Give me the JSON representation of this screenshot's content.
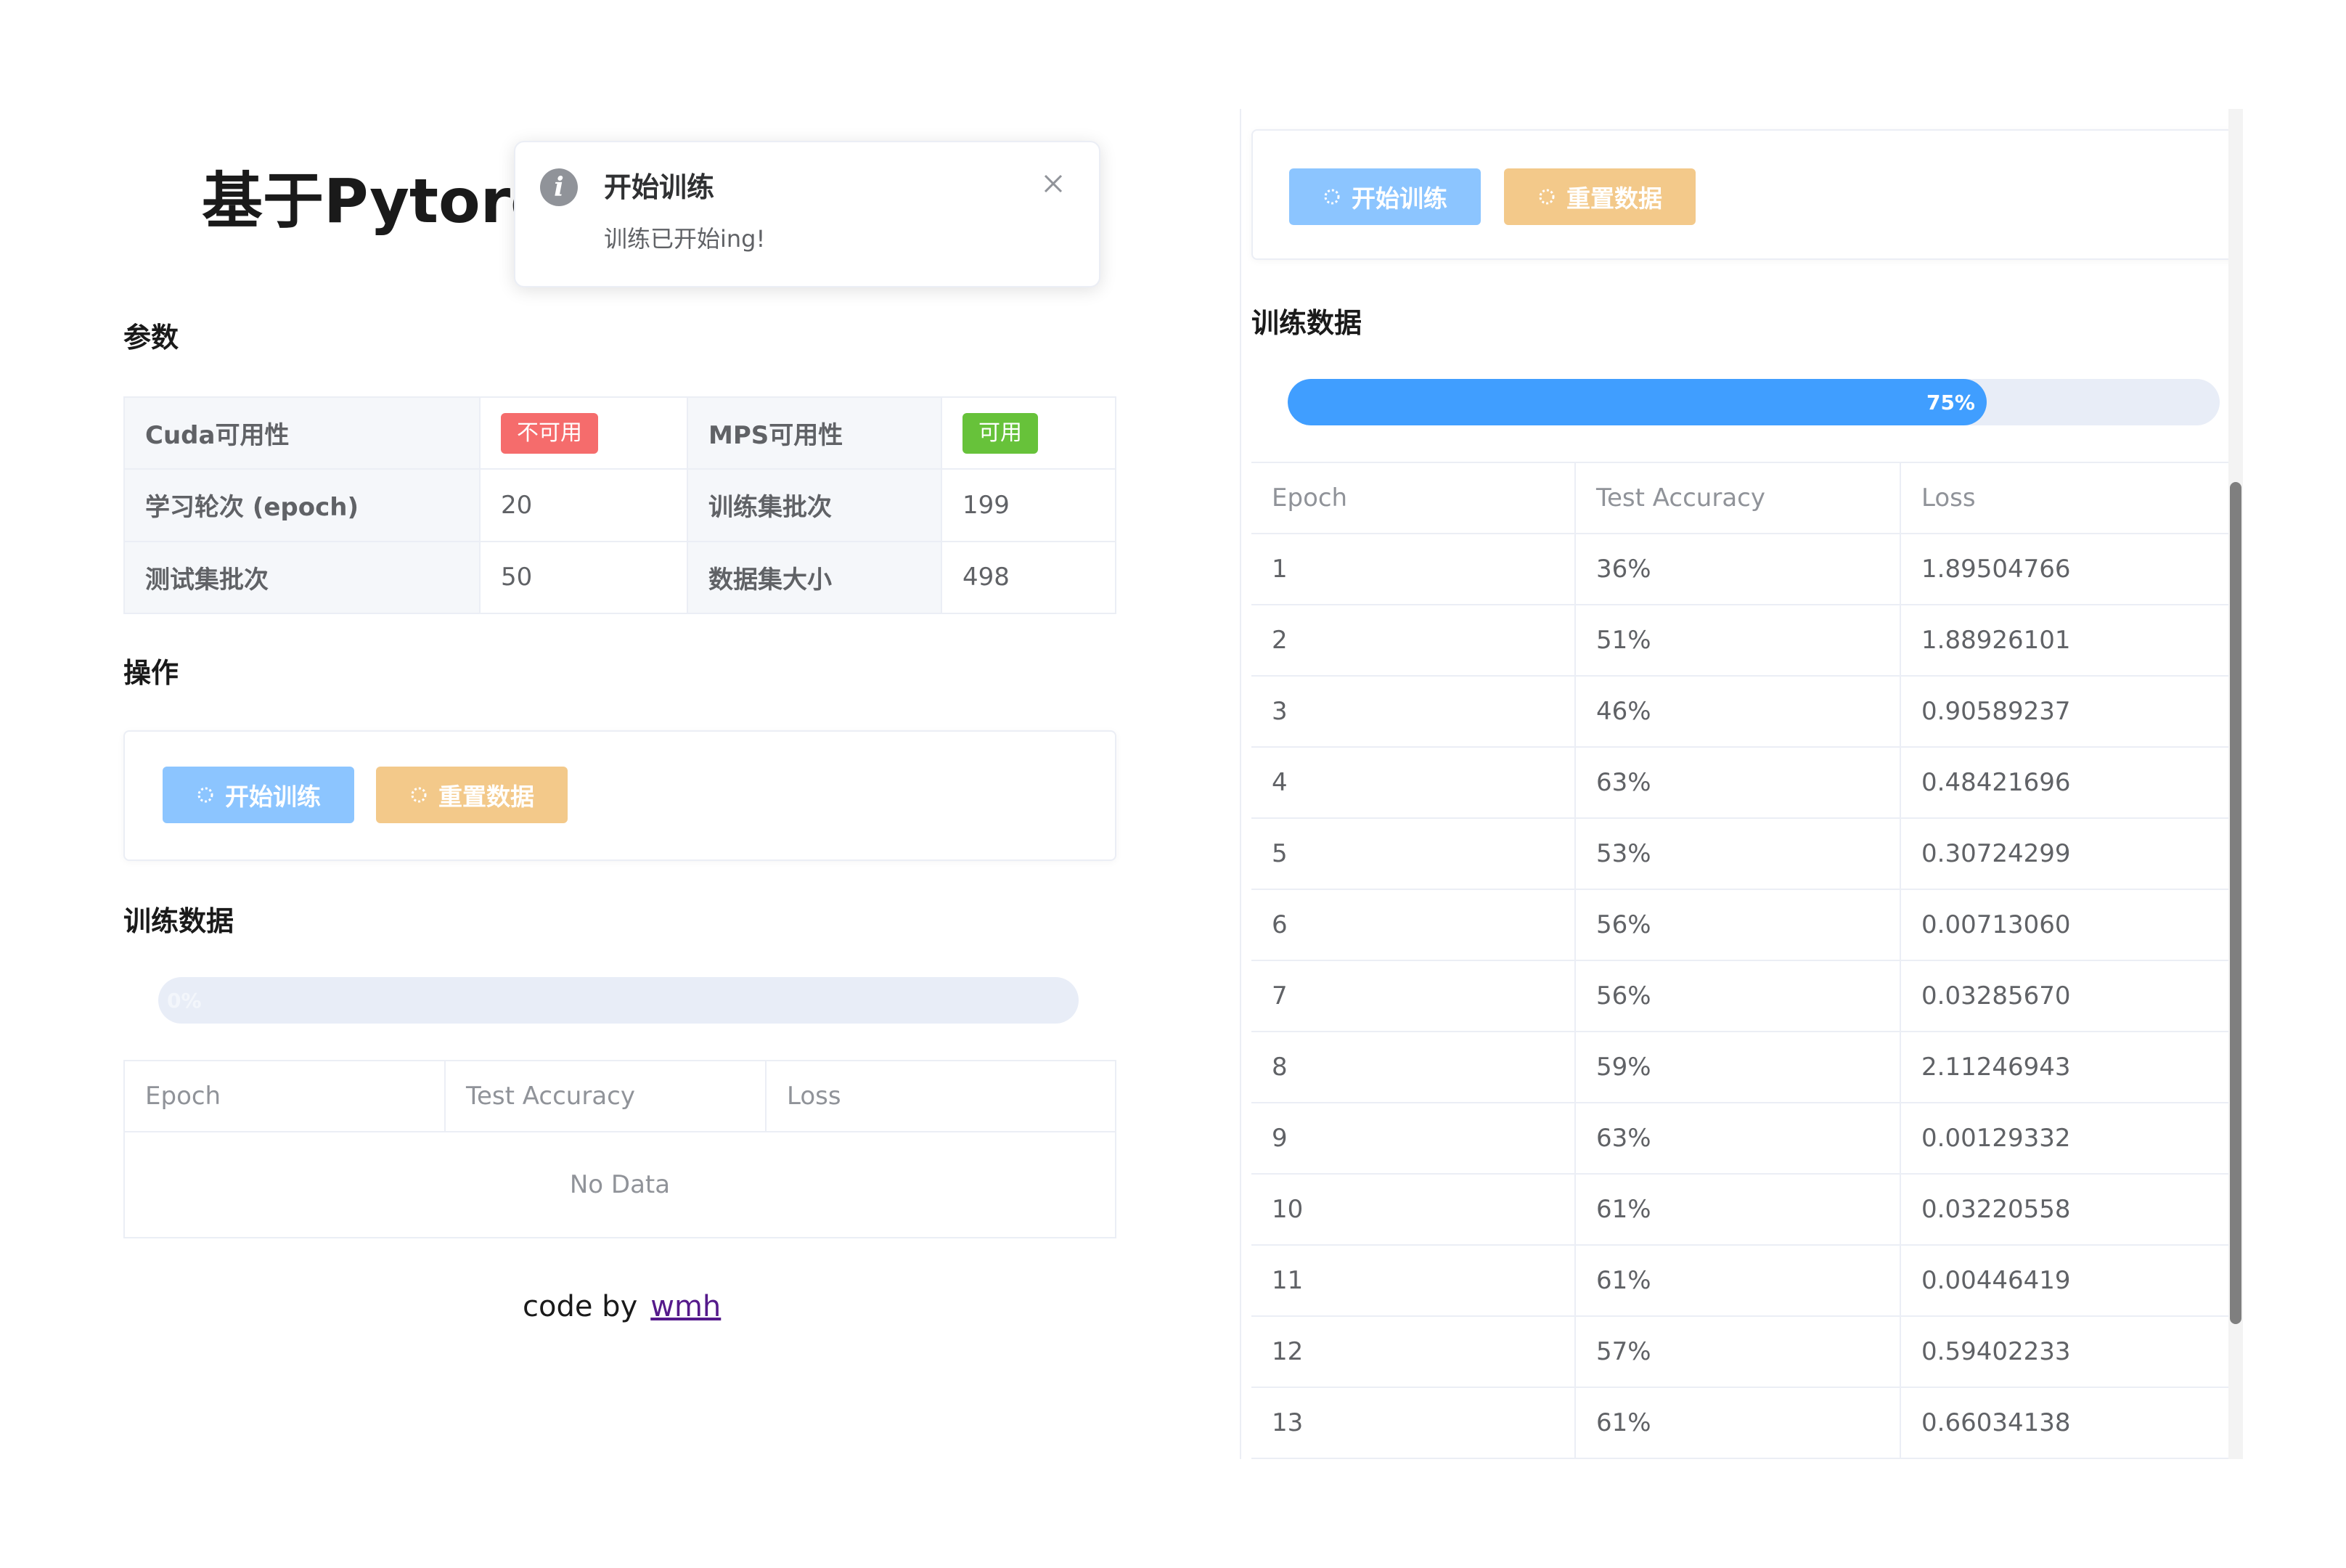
{
  "app": {
    "title": "基于Pytorch"
  },
  "sections": {
    "params": "参数",
    "operations": "操作",
    "training_data": "训练数据"
  },
  "params": {
    "cuda_label": "Cuda可用性",
    "cuda_value": "不可用",
    "mps_label": "MPS可用性",
    "mps_value": "可用",
    "epoch_label": "学习轮次 (epoch)",
    "epoch_value": "20",
    "train_batches_label": "训练集批次",
    "train_batches_value": "199",
    "test_batches_label": "测试集批次",
    "test_batches_value": "50",
    "dataset_size_label": "数据集大小",
    "dataset_size_value": "498"
  },
  "buttons": {
    "start_training": "开始训练",
    "reset_data": "重置数据"
  },
  "left_progress": {
    "percent": 0,
    "label": "0%"
  },
  "right_progress": {
    "percent": 75,
    "label": "75%"
  },
  "table": {
    "headers": [
      "Epoch",
      "Test Accuracy",
      "Loss"
    ],
    "empty_text": "No Data",
    "rows": [
      [
        "1",
        "36%",
        "1.89504766"
      ],
      [
        "2",
        "51%",
        "1.88926101"
      ],
      [
        "3",
        "46%",
        "0.90589237"
      ],
      [
        "4",
        "63%",
        "0.48421696"
      ],
      [
        "5",
        "53%",
        "0.30724299"
      ],
      [
        "6",
        "56%",
        "0.00713060"
      ],
      [
        "7",
        "56%",
        "0.03285670"
      ],
      [
        "8",
        "59%",
        "2.11246943"
      ],
      [
        "9",
        "63%",
        "0.00129332"
      ],
      [
        "10",
        "61%",
        "0.03220558"
      ],
      [
        "11",
        "61%",
        "0.00446419"
      ],
      [
        "12",
        "57%",
        "0.59402233"
      ],
      [
        "13",
        "61%",
        "0.66034138"
      ]
    ]
  },
  "footer": {
    "prefix": "code by",
    "author": "wmh"
  },
  "notification": {
    "title": "开始训练",
    "message": "训练已开始ing!",
    "icon": "info-icon"
  },
  "colors": {
    "primary": "#409eff",
    "primary_light": "#8cc5ff",
    "warning_light": "#f3c98a",
    "danger": "#f56c6c",
    "success": "#67c23a"
  }
}
